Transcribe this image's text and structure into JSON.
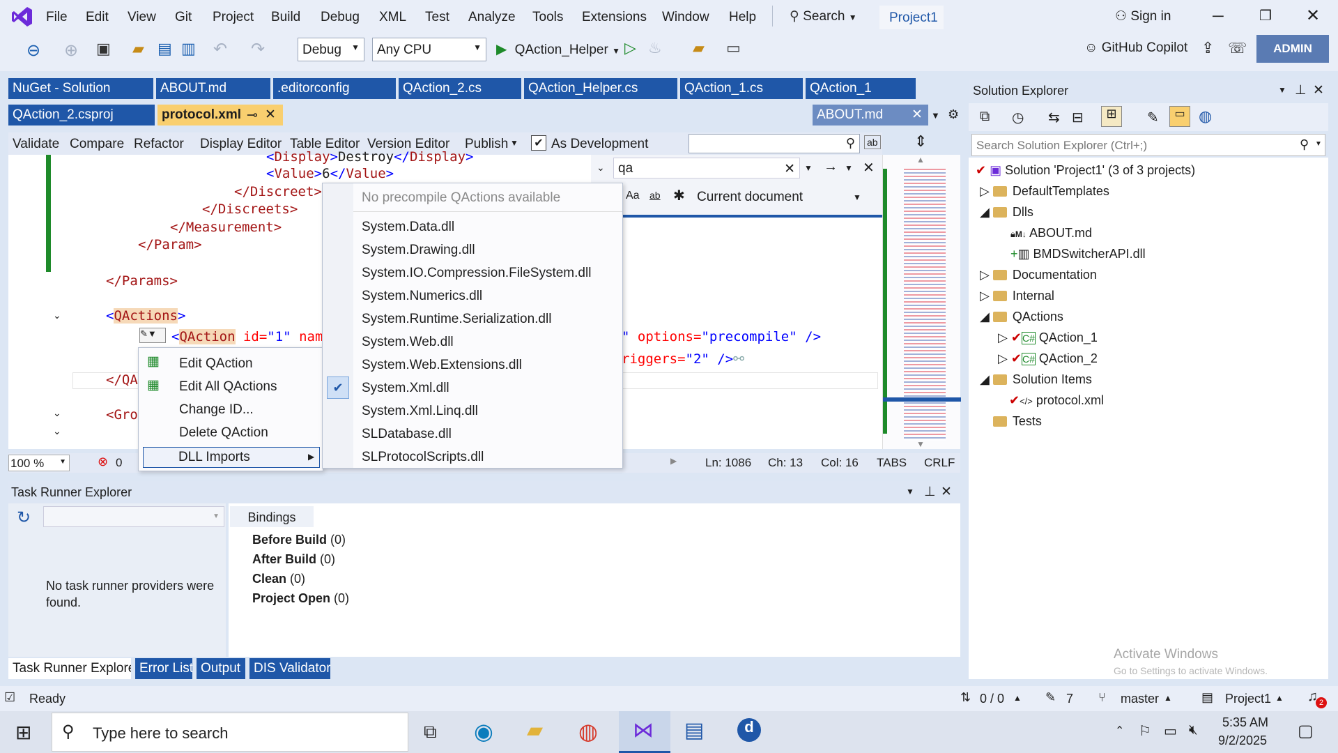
{
  "menu": {
    "items": [
      "File",
      "Edit",
      "View",
      "Git",
      "Project",
      "Build",
      "Debug",
      "XML",
      "Test",
      "Analyze",
      "Tools",
      "Extensions",
      "Window",
      "Help"
    ],
    "search": "Search",
    "project_badge": "Project1",
    "sign_in": "Sign in"
  },
  "toolbar": {
    "config": "Debug",
    "platform": "Any CPU",
    "startup": "QAction_Helper",
    "copilot": "GitHub Copilot",
    "admin": "ADMIN"
  },
  "tabs_row1": [
    "NuGet - Solution",
    "ABOUT.md",
    ".editorconfig",
    "QAction_2.cs",
    "QAction_Helper.cs",
    "QAction_1.cs",
    "QAction_1"
  ],
  "tabs_row2": {
    "a": "QAction_2.csproj",
    "b": "protocol.xml",
    "c": "ABOUT.md"
  },
  "editor_toolbar": [
    "Validate",
    "Compare",
    "Refactor",
    "Display Editor",
    "Table Editor",
    "Version Editor",
    "Publish",
    "As Development"
  ],
  "code": {
    "l1a": "<",
    "l1t": "Display",
    "l1b": ">",
    "l1v": "Destroy",
    "l1c": "</",
    "l1t2": "Display",
    "l1d": ">",
    "l2a": "<",
    "l2t": "Value",
    "l2b": ">",
    "l2v": "6",
    "l2c": "</",
    "l2t2": "Value",
    "l2d": ">",
    "l3": "</Discreet>",
    "l4": "</Discreets>",
    "l5": "</Measurement>",
    "l6": "</Param>",
    "l7": "</Params>",
    "l8a": "<",
    "l8t": "QActions",
    "l8b": ">",
    "l9a": "<",
    "l9t": "QAction",
    "l9attr": " id=",
    "l9val": "\"1\"",
    "l9n": " nam",
    "l9r1": "\" ",
    "l9r2": "options=",
    "l9r3": "\"precompile\"",
    "l9r4": " />",
    "l10a": "riggers=",
    "l10b": "\"2\"",
    "l10c": " />",
    "l11": "</QA",
    "l12": "<Gro"
  },
  "find": {
    "query": "qa",
    "scope": "Current document",
    "aa": "Aa",
    "ab": "ab"
  },
  "context_menu": [
    "Edit QAction",
    "Edit All QActions",
    "Change ID...",
    "Delete QAction",
    "DLL Imports"
  ],
  "dll_menu": {
    "header": "No precompile QActions available",
    "items": [
      "System.Data.dll",
      "System.Drawing.dll",
      "System.IO.Compression.FileSystem.dll",
      "System.Numerics.dll",
      "System.Runtime.Serialization.dll",
      "System.Web.dll",
      "System.Web.Extensions.dll",
      "System.Xml.dll",
      "System.Xml.Linq.dll",
      "SLDatabase.dll",
      "SLProtocolScripts.dll"
    ],
    "checked_index": 7
  },
  "editor_status": {
    "zoom": "100 %",
    "errors": "0",
    "ln": "Ln: 1086",
    "ch": "Ch: 13",
    "col": "Col: 16",
    "tabs": "TABS",
    "eol": "CRLF"
  },
  "task_runner": {
    "title": "Task Runner Explorer",
    "bindings_tab": "Bindings",
    "empty": "No task runner providers were found.",
    "bindings": [
      {
        "name": "Before Build",
        "count": "(0)"
      },
      {
        "name": "After Build",
        "count": "(0)"
      },
      {
        "name": "Clean",
        "count": "(0)"
      },
      {
        "name": "Project Open",
        "count": "(0)"
      }
    ]
  },
  "bottom_tabs": [
    "Task Runner Explorer",
    "Error List",
    "Output",
    "DIS Validator"
  ],
  "solution": {
    "title": "Solution Explorer",
    "search_placeholder": "Search Solution Explorer (Ctrl+;)",
    "root": "Solution 'Project1' (3 of 3 projects)",
    "items": [
      "DefaultTemplates",
      "Dlls",
      "ABOUT.md",
      "BMDSwitcherAPI.dll",
      "Documentation",
      "Internal",
      "QActions",
      "QAction_1",
      "QAction_2",
      "Solution Items",
      "protocol.xml",
      "Tests"
    ],
    "watermark1": "Activate Windows",
    "watermark2": "Go to Settings to activate Windows."
  },
  "status": {
    "ready": "Ready",
    "sync": "0 / 0",
    "edits": "7",
    "branch": "master",
    "project": "Project1",
    "notif": "2"
  },
  "taskbar": {
    "search": "Type here to search",
    "time": "5:35 AM",
    "date": "9/2/2025"
  },
  "colors": {
    "accent": "#1f57a8",
    "active_tab": "#f9cf6f",
    "vs_purple": "#68217a"
  }
}
